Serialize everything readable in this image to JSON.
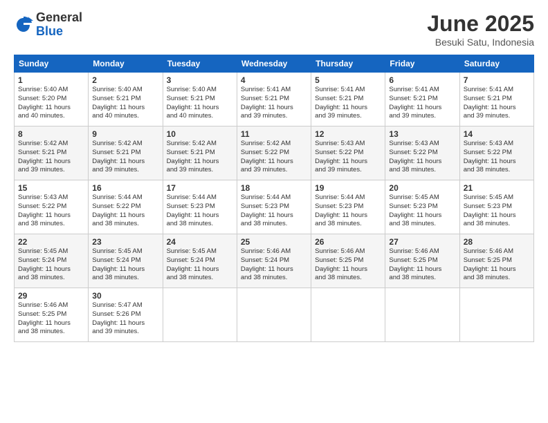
{
  "logo": {
    "general": "General",
    "blue": "Blue"
  },
  "title": "June 2025",
  "subtitle": "Besuki Satu, Indonesia",
  "days_of_week": [
    "Sunday",
    "Monday",
    "Tuesday",
    "Wednesday",
    "Thursday",
    "Friday",
    "Saturday"
  ],
  "weeks": [
    [
      {
        "day": "1",
        "info": "Sunrise: 5:40 AM\nSunset: 5:20 PM\nDaylight: 11 hours\nand 40 minutes."
      },
      {
        "day": "2",
        "info": "Sunrise: 5:40 AM\nSunset: 5:21 PM\nDaylight: 11 hours\nand 40 minutes."
      },
      {
        "day": "3",
        "info": "Sunrise: 5:40 AM\nSunset: 5:21 PM\nDaylight: 11 hours\nand 40 minutes."
      },
      {
        "day": "4",
        "info": "Sunrise: 5:41 AM\nSunset: 5:21 PM\nDaylight: 11 hours\nand 39 minutes."
      },
      {
        "day": "5",
        "info": "Sunrise: 5:41 AM\nSunset: 5:21 PM\nDaylight: 11 hours\nand 39 minutes."
      },
      {
        "day": "6",
        "info": "Sunrise: 5:41 AM\nSunset: 5:21 PM\nDaylight: 11 hours\nand 39 minutes."
      },
      {
        "day": "7",
        "info": "Sunrise: 5:41 AM\nSunset: 5:21 PM\nDaylight: 11 hours\nand 39 minutes."
      }
    ],
    [
      {
        "day": "8",
        "info": "Sunrise: 5:42 AM\nSunset: 5:21 PM\nDaylight: 11 hours\nand 39 minutes."
      },
      {
        "day": "9",
        "info": "Sunrise: 5:42 AM\nSunset: 5:21 PM\nDaylight: 11 hours\nand 39 minutes."
      },
      {
        "day": "10",
        "info": "Sunrise: 5:42 AM\nSunset: 5:21 PM\nDaylight: 11 hours\nand 39 minutes."
      },
      {
        "day": "11",
        "info": "Sunrise: 5:42 AM\nSunset: 5:22 PM\nDaylight: 11 hours\nand 39 minutes."
      },
      {
        "day": "12",
        "info": "Sunrise: 5:43 AM\nSunset: 5:22 PM\nDaylight: 11 hours\nand 39 minutes."
      },
      {
        "day": "13",
        "info": "Sunrise: 5:43 AM\nSunset: 5:22 PM\nDaylight: 11 hours\nand 38 minutes."
      },
      {
        "day": "14",
        "info": "Sunrise: 5:43 AM\nSunset: 5:22 PM\nDaylight: 11 hours\nand 38 minutes."
      }
    ],
    [
      {
        "day": "15",
        "info": "Sunrise: 5:43 AM\nSunset: 5:22 PM\nDaylight: 11 hours\nand 38 minutes."
      },
      {
        "day": "16",
        "info": "Sunrise: 5:44 AM\nSunset: 5:22 PM\nDaylight: 11 hours\nand 38 minutes."
      },
      {
        "day": "17",
        "info": "Sunrise: 5:44 AM\nSunset: 5:23 PM\nDaylight: 11 hours\nand 38 minutes."
      },
      {
        "day": "18",
        "info": "Sunrise: 5:44 AM\nSunset: 5:23 PM\nDaylight: 11 hours\nand 38 minutes."
      },
      {
        "day": "19",
        "info": "Sunrise: 5:44 AM\nSunset: 5:23 PM\nDaylight: 11 hours\nand 38 minutes."
      },
      {
        "day": "20",
        "info": "Sunrise: 5:45 AM\nSunset: 5:23 PM\nDaylight: 11 hours\nand 38 minutes."
      },
      {
        "day": "21",
        "info": "Sunrise: 5:45 AM\nSunset: 5:23 PM\nDaylight: 11 hours\nand 38 minutes."
      }
    ],
    [
      {
        "day": "22",
        "info": "Sunrise: 5:45 AM\nSunset: 5:24 PM\nDaylight: 11 hours\nand 38 minutes."
      },
      {
        "day": "23",
        "info": "Sunrise: 5:45 AM\nSunset: 5:24 PM\nDaylight: 11 hours\nand 38 minutes."
      },
      {
        "day": "24",
        "info": "Sunrise: 5:45 AM\nSunset: 5:24 PM\nDaylight: 11 hours\nand 38 minutes."
      },
      {
        "day": "25",
        "info": "Sunrise: 5:46 AM\nSunset: 5:24 PM\nDaylight: 11 hours\nand 38 minutes."
      },
      {
        "day": "26",
        "info": "Sunrise: 5:46 AM\nSunset: 5:25 PM\nDaylight: 11 hours\nand 38 minutes."
      },
      {
        "day": "27",
        "info": "Sunrise: 5:46 AM\nSunset: 5:25 PM\nDaylight: 11 hours\nand 38 minutes."
      },
      {
        "day": "28",
        "info": "Sunrise: 5:46 AM\nSunset: 5:25 PM\nDaylight: 11 hours\nand 38 minutes."
      }
    ],
    [
      {
        "day": "29",
        "info": "Sunrise: 5:46 AM\nSunset: 5:25 PM\nDaylight: 11 hours\nand 38 minutes."
      },
      {
        "day": "30",
        "info": "Sunrise: 5:47 AM\nSunset: 5:26 PM\nDaylight: 11 hours\nand 39 minutes."
      },
      {
        "day": "",
        "info": ""
      },
      {
        "day": "",
        "info": ""
      },
      {
        "day": "",
        "info": ""
      },
      {
        "day": "",
        "info": ""
      },
      {
        "day": "",
        "info": ""
      }
    ]
  ]
}
